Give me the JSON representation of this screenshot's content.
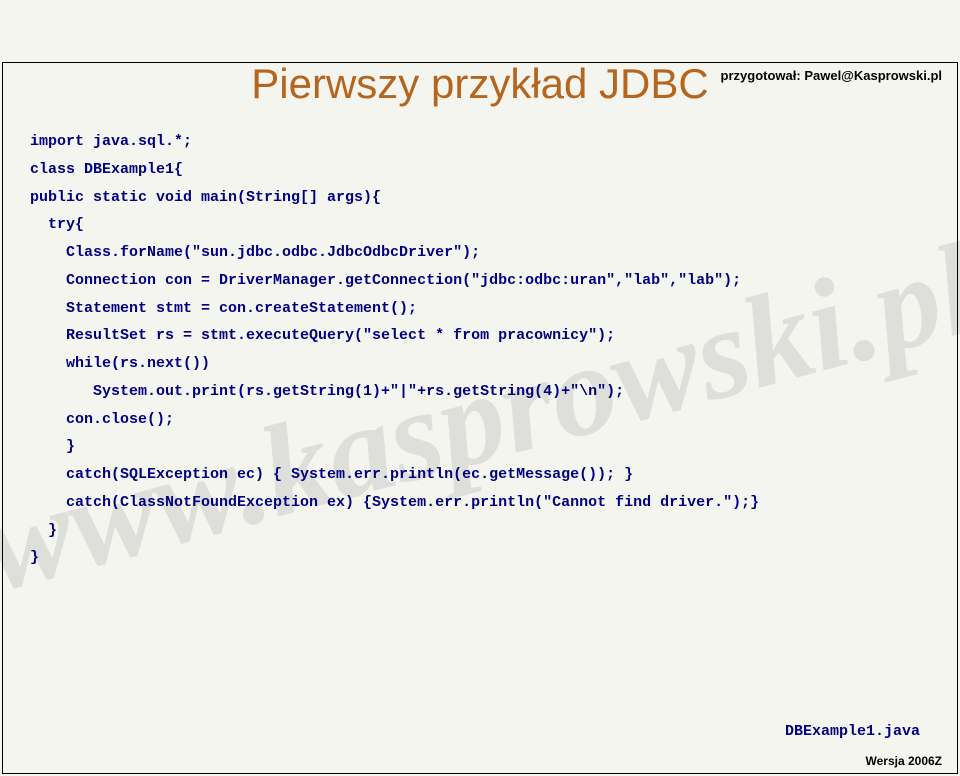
{
  "header": "przygotował: Pawel@Kasprowski.pl",
  "watermark": "www.kasprowski.pl",
  "title": "Pierwszy przykład JDBC",
  "code_lines": [
    "import java.sql.*;",
    "class DBExample1{",
    "public static void main(String[] args){",
    "  try{",
    "    Class.forName(\"sun.jdbc.odbc.JdbcOdbcDriver\");",
    "    Connection con = DriverManager.getConnection(\"jdbc:odbc:uran\",\"lab\",\"lab\");",
    "    Statement stmt = con.createStatement();",
    "    ResultSet rs = stmt.executeQuery(\"select * from pracownicy\");",
    "    while(rs.next())",
    "       System.out.print(rs.getString(1)+\"|\"+rs.getString(4)+\"\\n\");",
    "    con.close();",
    "    }",
    "    catch(SQLException ec) { System.err.println(ec.getMessage()); }",
    "    catch(ClassNotFoundException ex) {System.err.println(\"Cannot find driver.\");}",
    "  }",
    "}"
  ],
  "filename": "DBExample1.java",
  "footer": "Wersja 2006Z"
}
